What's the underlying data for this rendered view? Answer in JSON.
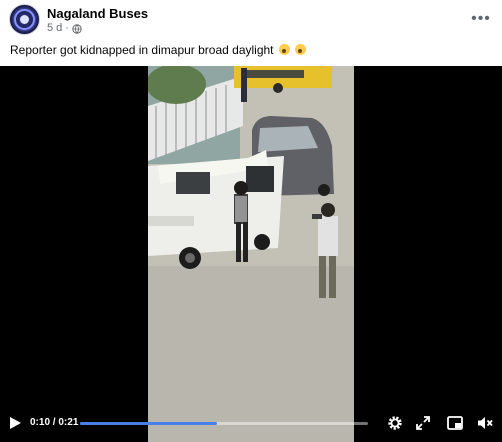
{
  "post": {
    "page_name": "Nagaland Buses",
    "age": "5 d",
    "separator": "·",
    "caption": "Reporter got kidnapped in dimapur broad daylight",
    "more_label": "•••"
  },
  "icons": {
    "avatar": "nagaland-buses-logo",
    "audience": "globe-icon",
    "more": "more-options-icon",
    "caption_emoji": "astonished-face-emoji",
    "play": "play-icon",
    "settings": "gear-icon",
    "expand": "expand-arrows-icon",
    "pip": "picture-in-picture-icon",
    "volume": "speaker-muted-icon"
  },
  "video": {
    "current_time": "0:10",
    "duration": "0:21",
    "time_display": "0:10 / 0:21",
    "progress_percent": 47.6
  },
  "colors": {
    "text_primary": "#050505",
    "text_secondary": "#65676b",
    "progress": "#4a7ee8",
    "video_bg": "#000000"
  }
}
